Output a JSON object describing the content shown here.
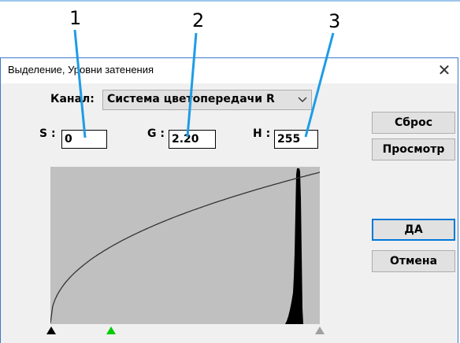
{
  "annotations": {
    "callout_1": "1",
    "callout_2": "2",
    "callout_3": "3"
  },
  "dialog": {
    "title": "Выделение, Уровни затенения",
    "close_glyph": "✕"
  },
  "channel": {
    "label": "Канал:",
    "value": "Система цветопередачи R"
  },
  "fields": {
    "s_label": "S :",
    "s_value": "0",
    "g_label": "G :",
    "g_value": "2.20",
    "h_label": "H :",
    "h_value": "255"
  },
  "buttons": {
    "reset": "Сброс",
    "preview": "Просмотр",
    "ok": "ДА",
    "cancel": "Отмена"
  },
  "graph": {
    "shadow_level": 0,
    "gamma": 2.2,
    "highlight_level": 255,
    "input_max": 255,
    "background_color": "#c0c0c0",
    "curve_color": "#333333",
    "histogram_color": "#000000",
    "markers": {
      "shadow_color": "#000000",
      "gamma_color": "#00cc00",
      "highlight_color": "#a0a0a0"
    }
  },
  "colors": {
    "accent": "#0078d7",
    "annotation_line": "#1e9ce6",
    "border": "#3d78c8"
  }
}
